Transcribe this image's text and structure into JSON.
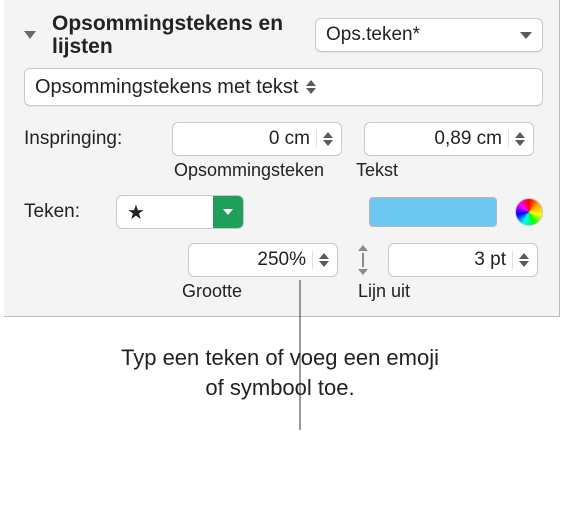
{
  "header": {
    "title": "Opsommings­tekens en lijsten",
    "style_value": "Ops.teken*"
  },
  "type_popup": {
    "value": "Opsommingstekens met tekst"
  },
  "indent": {
    "label": "Inspringing:",
    "bullet_value": "0 cm",
    "text_value": "0,89 cm",
    "bullet_caption": "Opsommingsteken",
    "text_caption": "Tekst"
  },
  "character": {
    "label": "Teken:",
    "glyph": "★",
    "swatch_color": "#6CC8F0"
  },
  "size": {
    "value": "250%",
    "caption": "Grootte"
  },
  "align": {
    "value": "3 pt",
    "caption": "Lijn uit"
  },
  "callout": {
    "text": "Typ een teken of voeg een emoji of symbool toe."
  }
}
